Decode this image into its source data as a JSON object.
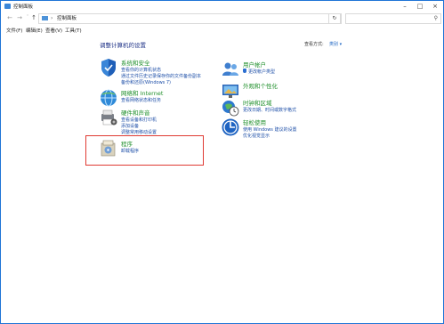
{
  "window": {
    "title": "控制面板"
  },
  "address": {
    "crumb": "控制面板",
    "search_placeholder": ""
  },
  "menu": [
    "文件(F)",
    "编辑(E)",
    "查看(V)",
    "工具(T)"
  ],
  "heading": "调整计算机的设置",
  "view_by": {
    "label": "查看方式:",
    "value": "类别 ▾"
  },
  "left_categories": [
    {
      "title": "系统和安全",
      "links": [
        "查看你的计算机状态",
        "通过文件历史记录保存你的文件备份副本",
        "备份和还原(Windows 7)"
      ]
    },
    {
      "title": "网络和 Internet",
      "links": [
        "查看网络状态和任务"
      ]
    },
    {
      "title": "硬件和声音",
      "links": [
        "查看设备和打印机",
        "添加设备",
        "调整常用移动设置"
      ]
    },
    {
      "title": "程序",
      "links": [
        "卸载程序"
      ]
    }
  ],
  "right_categories": [
    {
      "title": "用户帐户",
      "links": [
        "更改帐户类型"
      ]
    },
    {
      "title": "外观和个性化",
      "links": []
    },
    {
      "title": "时钟和区域",
      "links": [
        "更改日期、时间或数字格式"
      ]
    },
    {
      "title": "轻松使用",
      "links": [
        "使用 Windows 建议的设置",
        "优化视觉显示"
      ]
    }
  ],
  "colors": {
    "accent": "#1f74d6",
    "category_title": "#1f8f2b",
    "link": "#1e4fa8",
    "highlight": "#e03a33"
  }
}
